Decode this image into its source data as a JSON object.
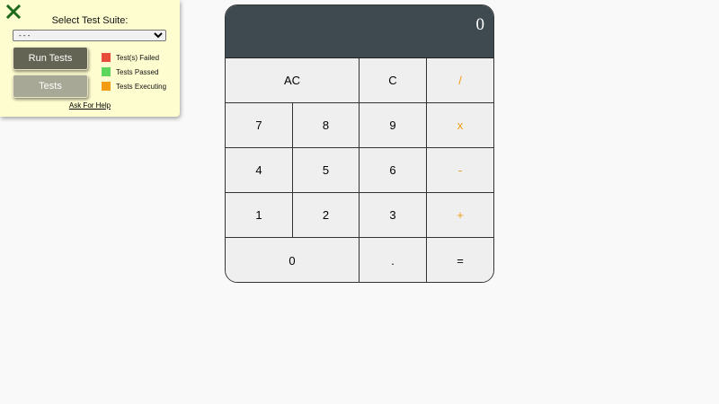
{
  "test_panel": {
    "close_icon": "close-x-icon",
    "close_color": "#1e6b1e",
    "suite_label": "Select Test Suite:",
    "suite_selected": "- - -",
    "run_tests_label": "Run Tests",
    "tests_label": "Tests",
    "legend": [
      {
        "label": "Test(s) Failed",
        "color": "#e74c3c"
      },
      {
        "label": "Tests Passed",
        "color": "#5cd65c"
      },
      {
        "label": "Tests Executing",
        "color": "#f39c12"
      }
    ],
    "help_link": "Ask For Help"
  },
  "calculator": {
    "display": "0",
    "keys": {
      "ac": "AC",
      "c": "C",
      "divide": "/",
      "seven": "7",
      "eight": "8",
      "nine": "9",
      "multiply": "x",
      "four": "4",
      "five": "5",
      "six": "6",
      "minus": "-",
      "one": "1",
      "two": "2",
      "three": "3",
      "plus": "+",
      "zero": "0",
      "decimal": ".",
      "equals": "="
    },
    "colors": {
      "display_bg": "#3f4a50",
      "key_bg": "#efefef",
      "operator": "#f39c12"
    }
  }
}
